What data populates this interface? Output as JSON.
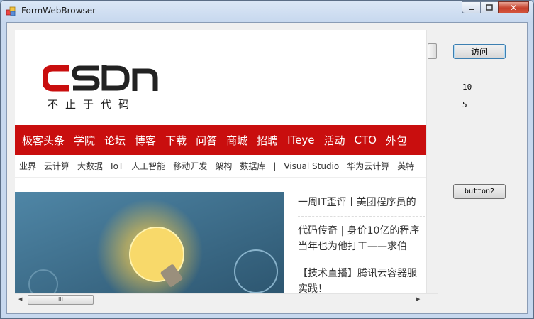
{
  "window": {
    "title": "FormWebBrowser",
    "close_glyph": "✕"
  },
  "colors": {
    "csdn_red": "#c90e0e",
    "window_frame": "#c7d8ee"
  },
  "page": {
    "slogan": "不止于代码",
    "nav": [
      "极客头条",
      "学院",
      "论坛",
      "博客",
      "下载",
      "问答",
      "商城",
      "招聘",
      "ITeye",
      "活动",
      "CTO",
      "外包"
    ],
    "subnav": [
      "业界",
      "云计算",
      "大数据",
      "IoT",
      "人工智能",
      "移动开发",
      "架构",
      "数据库",
      "|",
      "Visual Studio",
      "华为云计算",
      "英特"
    ],
    "headlines": [
      "一周IT歪评丨美团程序员的",
      "代码传奇 | 身价10亿的程序\n当年也为他打工——求伯",
      "【技术直播】腾讯云容器服\n实践！"
    ]
  },
  "scrollbar": {
    "grip": "III"
  },
  "controls": {
    "visit_button": "访问",
    "label1": "10",
    "label2": "5",
    "button2": "button2"
  }
}
